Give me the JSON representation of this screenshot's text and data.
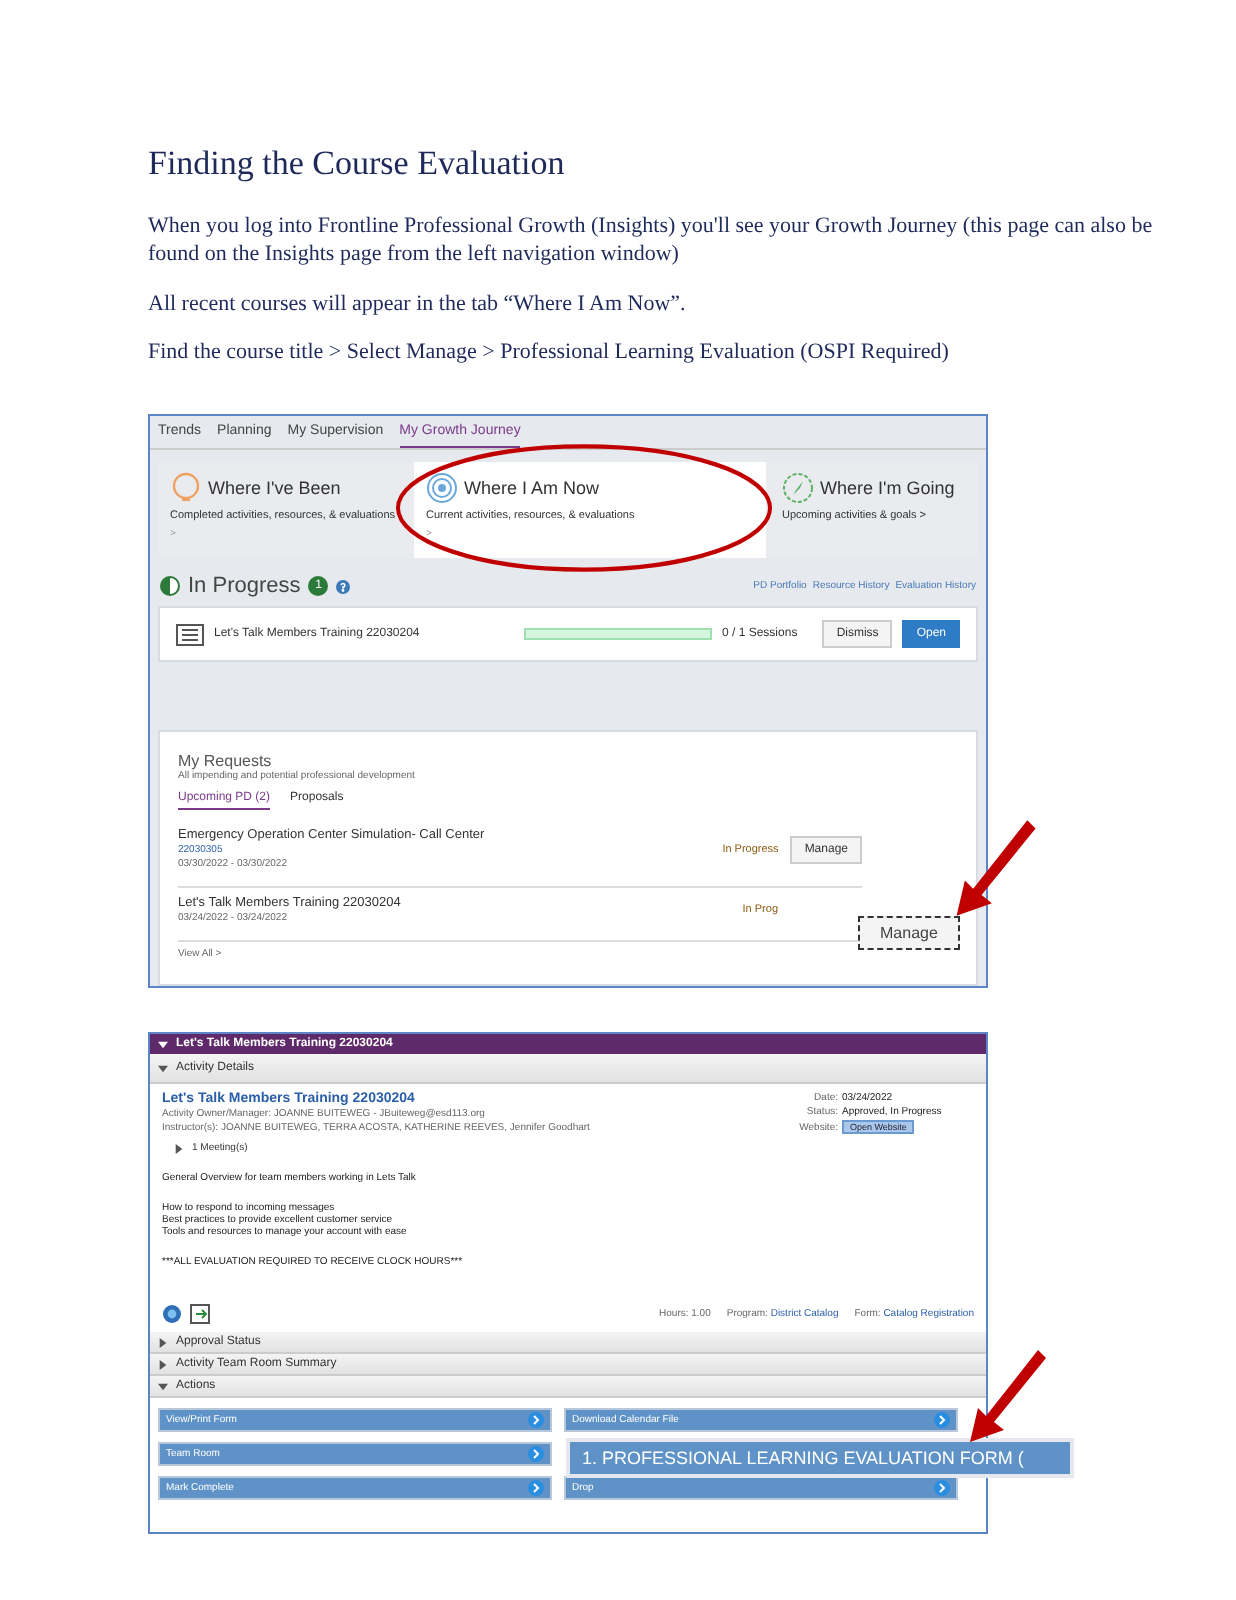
{
  "document": {
    "title": "Finding the Course Evaluation",
    "paragraphs": [
      "When you log into Frontline Professional Growth (Insights) you'll see your Growth Journey (this page can also be found on the Insights page from the left navigation window)",
      "All recent courses will appear in the tab “Where I Am Now”.",
      "Find the course title > Select Manage > Professional Learning Evaluation (OSPI Required)"
    ]
  },
  "growth_screen": {
    "tabs": [
      {
        "label": "Trends",
        "selected": false
      },
      {
        "label": "Planning",
        "selected": false
      },
      {
        "label": "My Supervision",
        "selected": false
      },
      {
        "label": "My Growth Journey",
        "selected": true
      }
    ],
    "journey_steps": [
      {
        "title": "Where I've Been",
        "subtitle": "Completed activities, resources, & evaluations",
        "link": ">",
        "selected": false
      },
      {
        "title": "Where I Am Now",
        "subtitle": "Current activities, resources, & evaluations",
        "link": ">",
        "selected": true
      },
      {
        "title": "Where I'm Going",
        "subtitle": "Upcoming activities & goals >",
        "selected": false
      }
    ],
    "in_progress": {
      "title": "In Progress",
      "count": "1",
      "links": [
        "PD Portfolio",
        "Resource History",
        "Evaluation History"
      ],
      "item": {
        "name": "Let's Talk Members Training 22030204",
        "level": 0,
        "sessions": "0 / 1 Sessions",
        "buttons": [
          "Dismiss",
          "Open"
        ]
      }
    },
    "requests": {
      "title": "My Requests",
      "subtitle": "All impending and potential professional development",
      "tabs": [
        {
          "label": "Upcoming PD (2)",
          "selected": true
        },
        {
          "label": "Proposals",
          "selected": false
        }
      ],
      "rows": [
        {
          "name": "Emergency Operation Center Simulation- Call Center",
          "code": "22030305",
          "dates": "03/30/2022 - 03/30/2022",
          "status": "In Progress",
          "button": "Manage"
        },
        {
          "name": "Let's Talk Members Training 22030204",
          "dates": "03/24/2022 - 03/24/2022",
          "status": "In Prog"
        }
      ],
      "view_all": "View All >"
    },
    "callout": "Manage"
  },
  "activity_screen": {
    "header": "Let's Talk Members Training 22030204",
    "details_title": "Activity Details",
    "activity_title": "Let's Talk Members Training 22030204",
    "meta": [
      "Activity Owner/Manager: JOANNE BUITEWEG - JBuiteweg@esd113.org",
      "Instructor(s): JOANNE BUITEWEG, TERRA ACOSTA, KATHERINE REEVES, Jennifer Goodhart"
    ],
    "meetings": "1 Meeting(s)",
    "side": [
      {
        "label": "Date:",
        "value": "03/24/2022"
      },
      {
        "label": "Status:",
        "value": "Approved, In Progress"
      },
      {
        "label": "Website:",
        "value": "Open Website"
      }
    ],
    "overview": "General Overview for team members working in Lets Talk",
    "bullets": [
      "How to respond to incoming messages",
      "Best practices to provide excellent customer service",
      "Tools and resources to manage your account with ease"
    ],
    "notice": "***ALL EVALUATION REQUIRED TO RECEIVE CLOCK HOURS***",
    "footer": [
      {
        "label": "Hours:",
        "value": "1.00"
      },
      {
        "label": "Program:",
        "value": "District Catalog"
      },
      {
        "label": "Form:",
        "value": "Catalog Registration"
      }
    ],
    "sections": [
      {
        "title": "Approval Status",
        "expanded": false
      },
      {
        "title": "Activity Team Room Summary",
        "expanded": false
      },
      {
        "title": "Actions",
        "expanded": true
      }
    ],
    "actions_left": [
      "View/Print Form",
      "Team Room",
      "Mark Complete"
    ],
    "actions_right": [
      "Download Calendar File",
      "Drop"
    ],
    "callout": "1. PROFESSIONAL LEARNING EVALUATION FORM ("
  }
}
